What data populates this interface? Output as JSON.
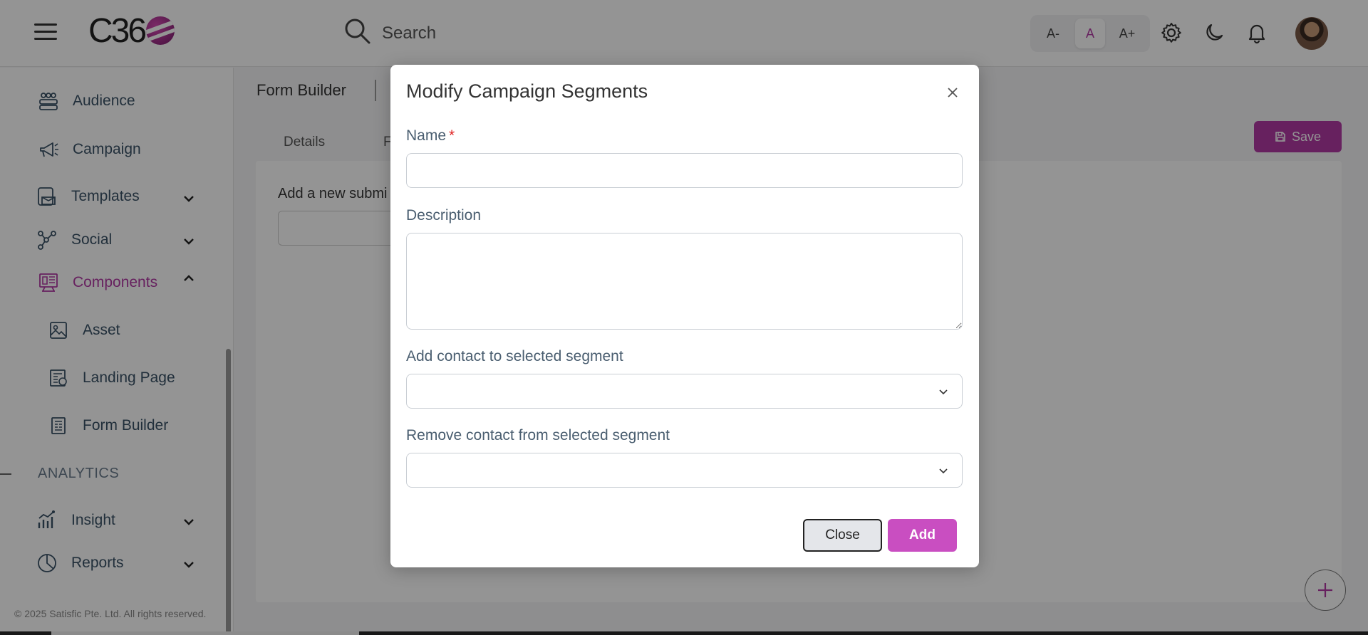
{
  "app": {
    "logo_text": "C36"
  },
  "header": {
    "search_placeholder": "Search",
    "font_controls": [
      "A-",
      "A",
      "A+"
    ],
    "icons": [
      "gear-icon",
      "moon-icon",
      "bell-icon"
    ]
  },
  "sidebar": {
    "items": [
      {
        "label": "Audience",
        "icon": "audience-icon"
      },
      {
        "label": "Campaign",
        "icon": "megaphone-icon"
      },
      {
        "label": "Templates",
        "icon": "template-icon"
      },
      {
        "label": "Social",
        "icon": "social-icon"
      },
      {
        "label": "Components",
        "icon": "components-icon"
      },
      {
        "label": "Asset",
        "icon": "image-icon"
      },
      {
        "label": "Landing Page",
        "icon": "landing-page-icon"
      },
      {
        "label": "Form Builder",
        "icon": "form-icon"
      },
      {
        "label": "Insight",
        "icon": "insight-icon"
      },
      {
        "label": "Reports",
        "icon": "pie-chart-icon"
      }
    ],
    "section_analytics": "ANALYTICS",
    "footer": "© 2025 Satisfic Pte. Ltd. All rights reserved."
  },
  "main": {
    "breadcrumb": "Form Builder",
    "tabs": [
      "Details",
      "F"
    ],
    "save_label": "Save",
    "card_label": "Add a new submi"
  },
  "modal": {
    "title": "Modify Campaign Segments",
    "name_label": "Name",
    "required_mark": "*",
    "name_value": "",
    "description_label": "Description",
    "description_value": "",
    "add_contact_label": "Add contact to selected segment",
    "remove_contact_label": "Remove contact from selected segment",
    "close_label": "Close",
    "add_label": "Add"
  },
  "colors": {
    "accent": "#b13aa4",
    "add_button": "#c94ec1",
    "required": "#e02424"
  }
}
